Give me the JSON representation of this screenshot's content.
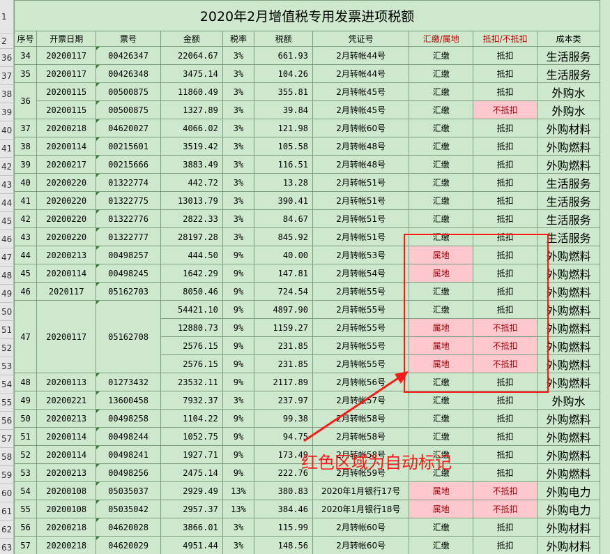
{
  "title": "2020年2月增值税专用发票进项税额",
  "row_numbers": [
    "1",
    "2",
    "36",
    "37",
    "38",
    "39",
    "40",
    "41",
    "42",
    "43",
    "44",
    "45",
    "46",
    "47",
    "48",
    "49",
    "50",
    "51",
    "52",
    "53",
    "54",
    "55",
    "56",
    "57",
    "58",
    "59",
    "60",
    "61",
    "62",
    "63"
  ],
  "headers": [
    "序号",
    "开票日期",
    "票号",
    "金额",
    "税率",
    "税额",
    "凭证号",
    "汇缴/属地",
    "抵扣/不抵扣",
    "成本类"
  ],
  "rows": [
    {
      "seq": "34",
      "date": "20200117",
      "inv": "00426347",
      "amt": "22064.67",
      "rate": "3%",
      "tax": "661.93",
      "voucher": "2月转帐44号",
      "pay": "汇缴",
      "ded": "抵扣",
      "cat": "生活服务"
    },
    {
      "seq": "35",
      "date": "20200117",
      "inv": "00426348",
      "amt": "3475.14",
      "rate": "3%",
      "tax": "104.26",
      "voucher": "2月转帐44号",
      "pay": "汇缴",
      "ded": "抵扣",
      "cat": "生活服务"
    },
    {
      "seq": "36",
      "date": "20200115",
      "inv": "00500875",
      "amt": "11860.49",
      "rate": "3%",
      "tax": "355.81",
      "voucher": "2月转帐45号",
      "pay": "汇缴",
      "ded": "抵扣",
      "cat": "外购水"
    },
    {
      "seq": "",
      "date": "20200115",
      "inv": "00500875",
      "amt": "1327.89",
      "rate": "3%",
      "tax": "39.84",
      "voucher": "2月转帐45号",
      "pay": "汇缴",
      "ded": "不抵扣",
      "cat": "外购水"
    },
    {
      "seq": "37",
      "date": "20200218",
      "inv": "04620027",
      "amt": "4066.02",
      "rate": "3%",
      "tax": "121.98",
      "voucher": "2月转帐60号",
      "pay": "汇缴",
      "ded": "抵扣",
      "cat": "外购材料"
    },
    {
      "seq": "38",
      "date": "20200114",
      "inv": "00215601",
      "amt": "3519.42",
      "rate": "3%",
      "tax": "105.58",
      "voucher": "2月转帐48号",
      "pay": "汇缴",
      "ded": "抵扣",
      "cat": "外购燃料"
    },
    {
      "seq": "39",
      "date": "20200217",
      "inv": "00215666",
      "amt": "3883.49",
      "rate": "3%",
      "tax": "116.51",
      "voucher": "2月转帐48号",
      "pay": "汇缴",
      "ded": "抵扣",
      "cat": "外购燃料"
    },
    {
      "seq": "40",
      "date": "20200220",
      "inv": "01322774",
      "amt": "442.72",
      "rate": "3%",
      "tax": "13.28",
      "voucher": "2月转帐51号",
      "pay": "汇缴",
      "ded": "抵扣",
      "cat": "生活服务"
    },
    {
      "seq": "41",
      "date": "20200220",
      "inv": "01322775",
      "amt": "13013.79",
      "rate": "3%",
      "tax": "390.41",
      "voucher": "2月转帐51号",
      "pay": "汇缴",
      "ded": "抵扣",
      "cat": "生活服务"
    },
    {
      "seq": "42",
      "date": "20200220",
      "inv": "01322776",
      "amt": "2822.33",
      "rate": "3%",
      "tax": "84.67",
      "voucher": "2月转帐51号",
      "pay": "汇缴",
      "ded": "抵扣",
      "cat": "生活服务"
    },
    {
      "seq": "43",
      "date": "20200220",
      "inv": "01322777",
      "amt": "28197.28",
      "rate": "3%",
      "tax": "845.92",
      "voucher": "2月转帐51号",
      "pay": "汇缴",
      "ded": "抵扣",
      "cat": "生活服务"
    },
    {
      "seq": "44",
      "date": "20200213",
      "inv": "00498257",
      "amt": "444.50",
      "rate": "9%",
      "tax": "40.00",
      "voucher": "2月转帐53号",
      "pay": "属地",
      "ded": "抵扣",
      "cat": "外购燃料"
    },
    {
      "seq": "45",
      "date": "20200114",
      "inv": "00498245",
      "amt": "1642.29",
      "rate": "9%",
      "tax": "147.81",
      "voucher": "2月转帐54号",
      "pay": "属地",
      "ded": "抵扣",
      "cat": "外购燃料"
    },
    {
      "seq": "46",
      "date": "2020117",
      "inv": "05162703",
      "amt": "8050.46",
      "rate": "9%",
      "tax": "724.54",
      "voucher": "2月转帐55号",
      "pay": "汇缴",
      "ded": "抵扣",
      "cat": "外购燃料"
    },
    {
      "seq": "47",
      "date": "20200117",
      "inv": "05162708",
      "amt": "54421.10",
      "rate": "9%",
      "tax": "4897.90",
      "voucher": "2月转帐55号",
      "pay": "汇缴",
      "ded": "抵扣",
      "cat": "外购燃料"
    },
    {
      "seq": "",
      "date": "",
      "inv": "",
      "amt": "12880.73",
      "rate": "9%",
      "tax": "1159.27",
      "voucher": "2月转帐55号",
      "pay": "属地",
      "ded": "不抵扣",
      "cat": "外购燃料"
    },
    {
      "seq": "",
      "date": "",
      "inv": "",
      "amt": "2576.15",
      "rate": "9%",
      "tax": "231.85",
      "voucher": "2月转帐55号",
      "pay": "属地",
      "ded": "不抵扣",
      "cat": "外购燃料"
    },
    {
      "seq": "",
      "date": "",
      "inv": "",
      "amt": "2576.15",
      "rate": "9%",
      "tax": "231.85",
      "voucher": "2月转帐55号",
      "pay": "属地",
      "ded": "不抵扣",
      "cat": "外购燃料"
    },
    {
      "seq": "48",
      "date": "20200113",
      "inv": "01273432",
      "amt": "23532.11",
      "rate": "9%",
      "tax": "2117.89",
      "voucher": "2月转帐56号",
      "pay": "汇缴",
      "ded": "抵扣",
      "cat": "外购燃料"
    },
    {
      "seq": "49",
      "date": "20200221",
      "inv": "13600458",
      "amt": "7932.37",
      "rate": "3%",
      "tax": "237.97",
      "voucher": "2月转帐57号",
      "pay": "汇缴",
      "ded": "抵扣",
      "cat": "外购水"
    },
    {
      "seq": "50",
      "date": "20200213",
      "inv": "00498258",
      "amt": "1104.22",
      "rate": "9%",
      "tax": "99.38",
      "voucher": "2月转帐58号",
      "pay": "汇缴",
      "ded": "抵扣",
      "cat": "外购燃料"
    },
    {
      "seq": "51",
      "date": "20200114",
      "inv": "00498244",
      "amt": "1052.75",
      "rate": "9%",
      "tax": "94.75",
      "voucher": "2月转帐58号",
      "pay": "汇缴",
      "ded": "抵扣",
      "cat": "外购燃料"
    },
    {
      "seq": "52",
      "date": "20200114",
      "inv": "00498241",
      "amt": "1927.71",
      "rate": "9%",
      "tax": "173.49",
      "voucher": "2月转帐58号",
      "pay": "汇缴",
      "ded": "抵扣",
      "cat": "外购燃料"
    },
    {
      "seq": "53",
      "date": "20200213",
      "inv": "00498256",
      "amt": "2475.14",
      "rate": "9%",
      "tax": "222.76",
      "voucher": "2月转帐59号",
      "pay": "汇缴",
      "ded": "抵扣",
      "cat": "外购燃料"
    },
    {
      "seq": "54",
      "date": "20200108",
      "inv": "05035037",
      "amt": "2929.49",
      "rate": "13%",
      "tax": "380.83",
      "voucher": "2020年1月银行17号",
      "pay": "属地",
      "ded": "不抵扣",
      "cat": "外购电力"
    },
    {
      "seq": "55",
      "date": "20200108",
      "inv": "05035042",
      "amt": "2957.37",
      "rate": "13%",
      "tax": "384.46",
      "voucher": "2020年1月银行18号",
      "pay": "属地",
      "ded": "不抵扣",
      "cat": "外购电力"
    },
    {
      "seq": "56",
      "date": "20200218",
      "inv": "04620028",
      "amt": "3866.01",
      "rate": "3%",
      "tax": "115.99",
      "voucher": "2月转帐60号",
      "pay": "汇缴",
      "ded": "抵扣",
      "cat": "外购材料"
    },
    {
      "seq": "57",
      "date": "20200218",
      "inv": "04620029",
      "amt": "4951.44",
      "rate": "3%",
      "tax": "148.56",
      "voucher": "2月转帐60号",
      "pay": "汇缴",
      "ded": "抵扣",
      "cat": "外购材料"
    }
  ],
  "annotation": "红色区域为自动标记",
  "colors": {
    "annotation_red": "#ff1a1a",
    "highlight_fill": "#ffc7ce",
    "highlight_text": "#9c0006",
    "sheet_bg": "#cde8cd"
  }
}
